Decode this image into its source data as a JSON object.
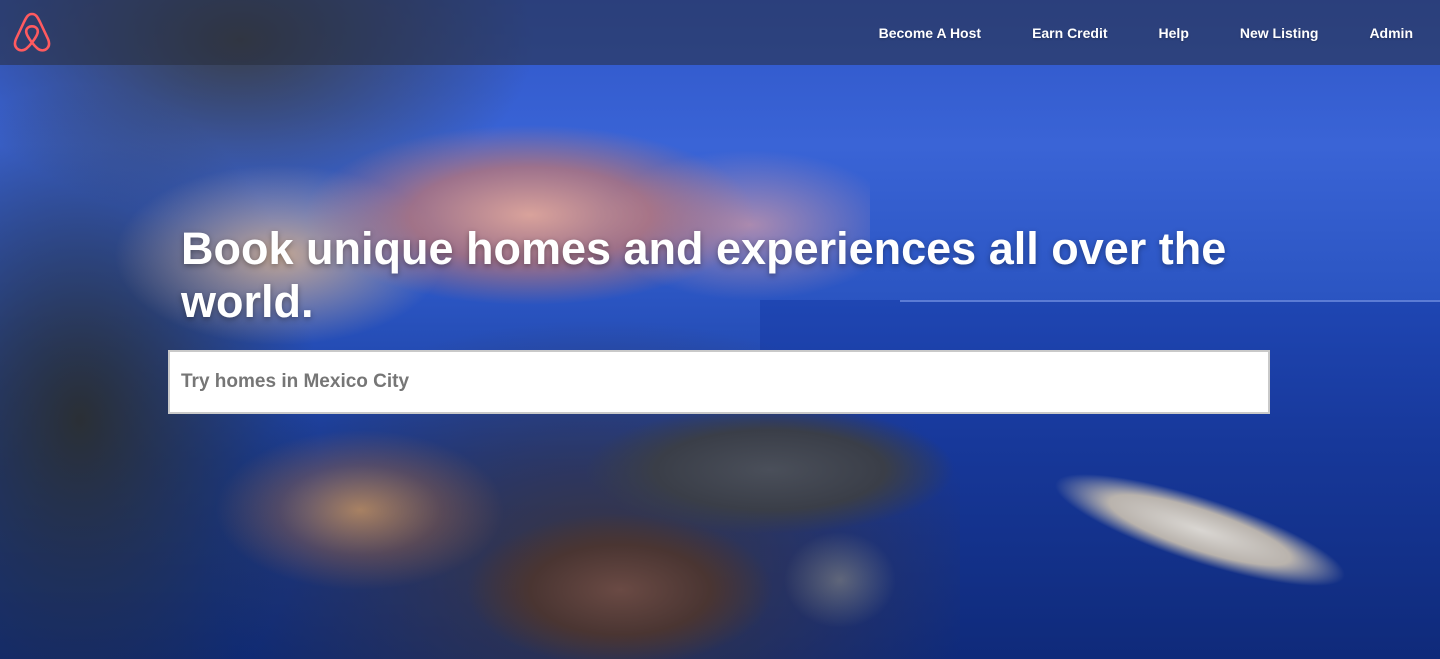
{
  "brand": {
    "logo_icon": "airbnb-belo-icon",
    "logo_color": "#ff5a5f"
  },
  "nav": {
    "links": [
      {
        "label": "Become A Host"
      },
      {
        "label": "Earn Credit"
      },
      {
        "label": "Help"
      },
      {
        "label": "New Listing"
      },
      {
        "label": "Admin"
      }
    ]
  },
  "hero": {
    "headline": "Book unique homes and experiences all over the world.",
    "search": {
      "placeholder": "Try homes in Mexico City",
      "value": ""
    }
  },
  "colors": {
    "nav_text": "#ffffff",
    "headline_text": "#ffffff",
    "search_placeholder": "#767676"
  }
}
